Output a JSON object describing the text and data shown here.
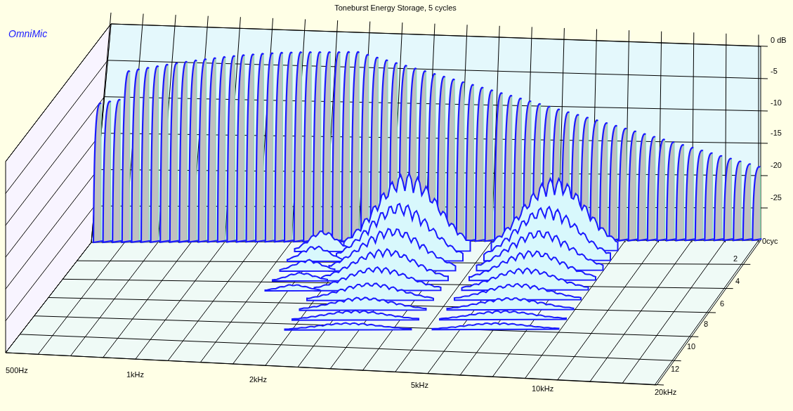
{
  "chart": {
    "title": "Toneburst Energy Storage, 5 cycles",
    "logo": "OmniMic",
    "level_axis": [
      "0 dB",
      "-5",
      "-10",
      "-15",
      "-20",
      "-25"
    ],
    "cycle_axis": [
      "0cyc",
      "2",
      "4",
      "6",
      "8",
      "10",
      "12"
    ],
    "frequency_axis": [
      "500Hz",
      "1kHz",
      "2kHz",
      "5kHz",
      "10kHz",
      "20kHz"
    ],
    "kind": "waterfall"
  }
}
